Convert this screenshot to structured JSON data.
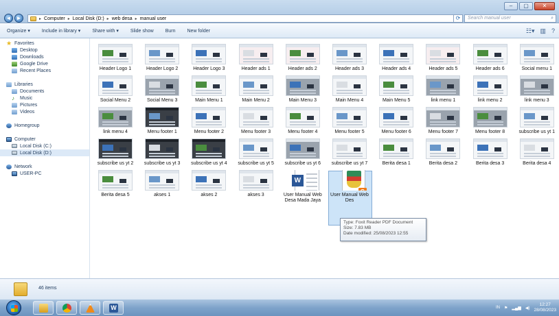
{
  "window": {
    "controls": [
      "–",
      "▢",
      "✕"
    ]
  },
  "address": {
    "back": "◄",
    "forward": "►",
    "crumbs": [
      "Computer",
      "Local Disk (D:)",
      "web desa",
      "manual user"
    ],
    "refresh": "⟳",
    "search_placeholder": "Search manual user"
  },
  "toolbar": {
    "organize": "Organize ▾",
    "include": "Include in library ▾",
    "share": "Share with ▾",
    "slideshow": "Slide show",
    "burn": "Burn",
    "newfolder": "New folder"
  },
  "sidebar": {
    "favorites": "Favorites",
    "desktop": "Desktop",
    "downloads": "Downloads",
    "googledrive": "Google Drive",
    "recent": "Recent Places",
    "libraries": "Libraries",
    "documents": "Documents",
    "music": "Music",
    "pictures": "Pictures",
    "videos": "Videos",
    "homegroup": "Homegroup",
    "computer": "Computer",
    "diskc": "Local Disk (C:)",
    "diskd": "Local Disk (D:)",
    "network": "Network",
    "userpc": "USER-PC"
  },
  "files": [
    {
      "name": "Header Logo 1",
      "style": "light"
    },
    {
      "name": "Header Logo 2",
      "style": "light"
    },
    {
      "name": "Header Logo 3",
      "style": "light"
    },
    {
      "name": "Header ads 1",
      "style": "pink"
    },
    {
      "name": "Header ads 2",
      "style": "pink"
    },
    {
      "name": "Header ads 3",
      "style": "light"
    },
    {
      "name": "Header ads 4",
      "style": "light"
    },
    {
      "name": "Header ads 5",
      "style": "pink"
    },
    {
      "name": "Header ads 6",
      "style": "light"
    },
    {
      "name": "Social menu 1",
      "style": "light"
    },
    {
      "name": "Social Menu 2",
      "style": "light"
    },
    {
      "name": "Social Menu 3",
      "style": "gray"
    },
    {
      "name": "Main Menu 1",
      "style": "light"
    },
    {
      "name": "Main Menu 2",
      "style": "light"
    },
    {
      "name": "Main Menu 3",
      "style": "gray"
    },
    {
      "name": "Main Menu 4",
      "style": "light"
    },
    {
      "name": "Main Menu 5",
      "style": "light"
    },
    {
      "name": "link menu 1",
      "style": "gray"
    },
    {
      "name": "link menu 2",
      "style": "light"
    },
    {
      "name": "link menu 3",
      "style": "gray"
    },
    {
      "name": "link menu 4",
      "style": "gray"
    },
    {
      "name": "Menu footer 1",
      "style": "dark"
    },
    {
      "name": "Menu footer 2",
      "style": "light"
    },
    {
      "name": "Menu footer 3",
      "style": "light"
    },
    {
      "name": "Menu footer 4",
      "style": "light"
    },
    {
      "name": "Menu footer 5",
      "style": "light"
    },
    {
      "name": "Menu footer 6",
      "style": "light"
    },
    {
      "name": "Menu footer 7",
      "style": "gray"
    },
    {
      "name": "Menu footer 8",
      "style": "gray"
    },
    {
      "name": "subscribe us yt 1",
      "style": "light"
    },
    {
      "name": "subscribe us yt 2",
      "style": "dark"
    },
    {
      "name": "subscribe us yt 3",
      "style": "dark"
    },
    {
      "name": "subscribe us yt 4",
      "style": "dark"
    },
    {
      "name": "subscribe us yt 5",
      "style": "light"
    },
    {
      "name": "subscribe us yt 6",
      "style": "gray"
    },
    {
      "name": "subscribe us yt 7",
      "style": "light"
    },
    {
      "name": "Berita desa 1",
      "style": "light"
    },
    {
      "name": "Berita desa 2",
      "style": "light"
    },
    {
      "name": "Berita desa 3",
      "style": "light"
    },
    {
      "name": "Berita desa 4",
      "style": "light"
    },
    {
      "name": "Berita desa 5",
      "style": "light"
    },
    {
      "name": "akses 1",
      "style": "light"
    },
    {
      "name": "akses 2",
      "style": "light"
    },
    {
      "name": "akses 3",
      "style": "light"
    },
    {
      "name": "User Manual Web Desa Mada Jaya",
      "style": "word"
    },
    {
      "name": "User Manual Web Des",
      "style": "pdf"
    }
  ],
  "tooltip": {
    "type": "Type: Foxit Reader PDF Document",
    "size": "Size: 7.83 MB",
    "modified": "Date modified: 25/08/2023 12:55"
  },
  "details": {
    "count": "46 items"
  },
  "taskbar": {
    "word_icon": "W",
    "tray_flag": "⚑",
    "tray_lang": "IN",
    "time": "12:27",
    "date": "28/08/2023"
  }
}
